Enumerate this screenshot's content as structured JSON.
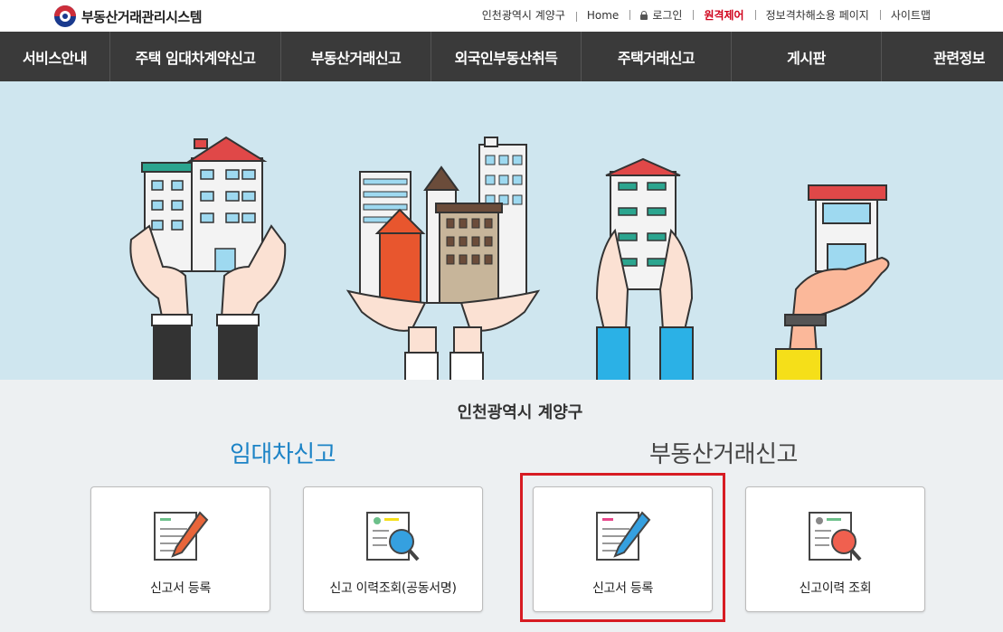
{
  "logo": {
    "title": "부동산거래관리시스템"
  },
  "util_links": [
    {
      "label": "인천광역시 계양구"
    },
    {
      "label": "Home"
    },
    {
      "label": "로그인"
    },
    {
      "label": "원격제어"
    },
    {
      "label": "정보격차해소용 페이지"
    },
    {
      "label": "사이트맵"
    }
  ],
  "nav": [
    {
      "label": "서비스안내"
    },
    {
      "label": "주택 임대차계약신고"
    },
    {
      "label": "부동산거래신고"
    },
    {
      "label": "외국인부동산취득"
    },
    {
      "label": "주택거래신고"
    },
    {
      "label": "게시판"
    },
    {
      "label": "관련정보"
    }
  ],
  "main": {
    "region": "인천광역시 계양구",
    "lease_title": "임대차신고",
    "trade_title": "부동산거래신고",
    "cards": [
      {
        "label": "신고서 등록",
        "icon": "form-pencil-icon",
        "accent": "#e8653a"
      },
      {
        "label": "신고 이력조회(공동서명)",
        "icon": "search-history-icon",
        "accent": "#35a0e0"
      },
      {
        "label": "신고서 등록",
        "icon": "form-pencil-icon",
        "accent": "#35a0e0"
      },
      {
        "label": "신고이력 조회",
        "icon": "search-history-icon",
        "accent": "#f0604f"
      }
    ]
  },
  "colors": {
    "nav_bg": "#3a3a3a",
    "hero_bg": "#cfe6ef",
    "lease_title": "#1c83c6",
    "highlight": "#d71c23"
  }
}
